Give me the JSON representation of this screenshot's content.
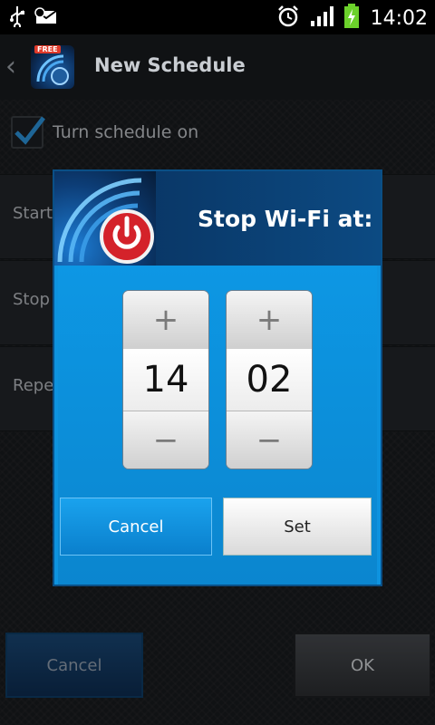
{
  "status_bar": {
    "time": "14:02",
    "left_icons": [
      "usb-icon",
      "notification-icon"
    ],
    "right_icons": [
      "alarm-icon",
      "signal-icon",
      "battery-charging-icon"
    ]
  },
  "header": {
    "title": "New Schedule",
    "app_icon_badge": "FREE"
  },
  "settings": {
    "turn_schedule_on_label": "Turn schedule on",
    "turn_schedule_on_checked": true,
    "rows": [
      {
        "label": "Start"
      },
      {
        "label": "Stop W"
      },
      {
        "label": "Repea"
      }
    ]
  },
  "footer": {
    "cancel_label": "Cancel",
    "ok_label": "OK"
  },
  "dialog": {
    "title": "Stop Wi-Fi at:",
    "hour": "14",
    "minute": "02",
    "plus_symbol": "+",
    "minus_symbol": "−",
    "cancel_label": "Cancel",
    "set_label": "Set"
  },
  "colors": {
    "accent": "#0e93df",
    "power_red": "#d4222a"
  }
}
